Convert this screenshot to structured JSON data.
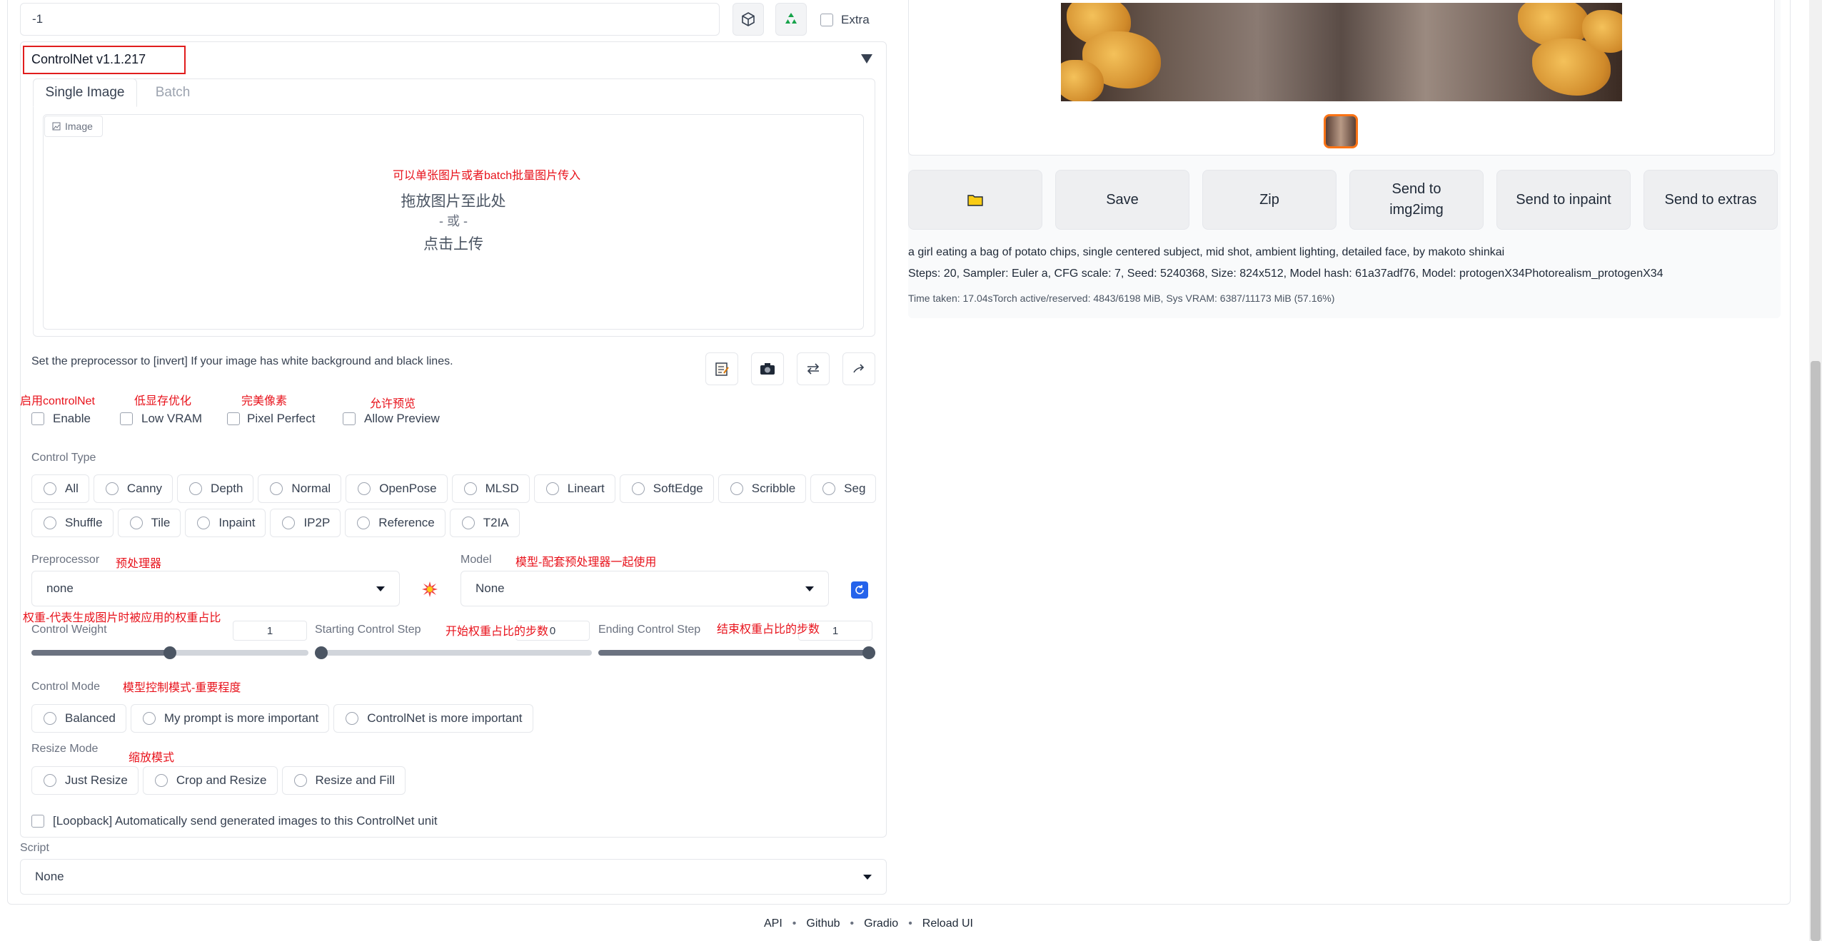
{
  "seed": {
    "value": "-1",
    "extra_label": "Extra"
  },
  "controlnet": {
    "title": "ControlNet v1.1.217",
    "tabs": [
      {
        "label": "Single Image"
      },
      {
        "label": "Batch"
      }
    ],
    "image_badge": "Image",
    "drop_note": "可以单张图片或者batch批量图片传入",
    "drop_line1": "拖放图片至此处",
    "drop_line2": "- 或 -",
    "drop_line3": "点击上传",
    "invert_hint": "Set the preprocessor to [invert] If your image has white background and black lines.",
    "toggles": [
      {
        "label": "Enable",
        "note": "启用controlNet"
      },
      {
        "label": "Low VRAM",
        "note": "低显存优化"
      },
      {
        "label": "Pixel Perfect",
        "note": "完美像素"
      },
      {
        "label": "Allow Preview",
        "note": "允许预览"
      }
    ],
    "control_type_label": "Control Type",
    "control_types_row1": [
      "All",
      "Canny",
      "Depth",
      "Normal",
      "OpenPose",
      "MLSD",
      "Lineart",
      "SoftEdge",
      "Scribble",
      "Seg"
    ],
    "control_types_row2": [
      "Shuffle",
      "Tile",
      "Inpaint",
      "IP2P",
      "Reference",
      "T2IA"
    ],
    "preprocessor": {
      "label": "Preprocessor",
      "note": "预处理器",
      "value": "none"
    },
    "model": {
      "label": "Model",
      "note": "模型-配套预处理器一起使用",
      "value": "None"
    },
    "weight_note": "权重-代表生成图片时被应用的权重占比",
    "control_weight": {
      "label": "Control Weight",
      "value": "1",
      "fraction": 0.5
    },
    "starting_step": {
      "label": "Starting Control Step",
      "note": "开始权重占比的步数",
      "value": "0",
      "fraction": 0.0
    },
    "ending_step": {
      "label": "Ending Control Step",
      "note": "结束权重占比的步数",
      "value": "1",
      "fraction": 1.0
    },
    "control_mode": {
      "label": "Control Mode",
      "note": "模型控制模式-重要程度",
      "options": [
        "Balanced",
        "My prompt is more important",
        "ControlNet is more important"
      ]
    },
    "resize_mode": {
      "label": "Resize Mode",
      "note": "缩放模式",
      "options": [
        "Just Resize",
        "Crop and Resize",
        "Resize and Fill"
      ]
    },
    "loopback": "[Loopback] Automatically send generated images to this ControlNet unit"
  },
  "script": {
    "label": "Script",
    "value": "None"
  },
  "output": {
    "buttons": [
      {
        "label": "",
        "icon": "folder-icon"
      },
      {
        "label": "Save"
      },
      {
        "label": "Zip"
      },
      {
        "label": "Send to\nimg2img"
      },
      {
        "label": "Send to inpaint"
      },
      {
        "label": "Send to extras"
      }
    ],
    "prompt": "a girl eating a bag of potato chips, single centered subject, mid shot, ambient lighting, detailed face, by makoto shinkai",
    "params": "Steps: 20, Sampler: Euler a, CFG scale: 7, Seed: 5240368, Size: 824x512, Model hash: 61a37adf76, Model: protogenX34Photorealism_protogenX34",
    "time": "Time taken: 17.04sTorch active/reserved: 4843/6198 MiB, Sys VRAM: 6387/11173 MiB (57.16%)"
  },
  "footer": [
    "API",
    "Github",
    "Gradio",
    "Reload UI"
  ],
  "colors": {
    "annotation": "#e8121b",
    "highlight_box": "#e11d1d",
    "thumb_border": "#f97316",
    "refresh_btn": "#2563eb"
  }
}
